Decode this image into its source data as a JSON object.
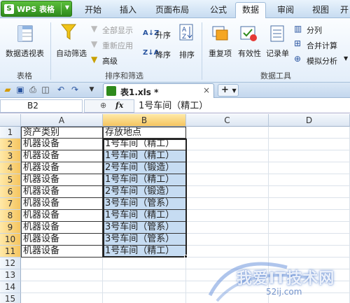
{
  "app": {
    "title": "WPS 表格"
  },
  "menu": {
    "tabs": [
      "开始",
      "插入",
      "页面布局",
      "公式",
      "数据",
      "审阅",
      "视图",
      "开"
    ],
    "active": "数据"
  },
  "ribbon": {
    "pivot": "数据透视表",
    "autofilter": "自动筛选",
    "show_all": "全部显示",
    "reapply": "重新应用",
    "advanced": "高级",
    "sort_asc": "升序",
    "sort_desc": "降序",
    "sort": "排序",
    "duplicates": "重复项",
    "validity": "有效性",
    "record": "记录单",
    "split": "分列",
    "consolidate": "合并计算",
    "simulate": "模拟分析",
    "group_table": "表格",
    "group_sortfilter": "排序和筛选",
    "group_datatools": "数据工具"
  },
  "doc": {
    "tab_name": "表1.xls *",
    "new_tab": "+"
  },
  "formula_bar": {
    "name_box": "B2",
    "fx": "fx",
    "value": "1号车间（精工）"
  },
  "grid": {
    "columns": [
      "A",
      "B",
      "C",
      "D"
    ],
    "rows": [
      {
        "n": "1",
        "a": "资产类别",
        "b": "存放地点"
      },
      {
        "n": "2",
        "a": "机器设备",
        "b": "1号车间（精工）"
      },
      {
        "n": "3",
        "a": "机器设备",
        "b": "1号车间（精工）"
      },
      {
        "n": "4",
        "a": "机器设备",
        "b": "2号车间（锻造）"
      },
      {
        "n": "5",
        "a": "机器设备",
        "b": "1号车间（精工）"
      },
      {
        "n": "6",
        "a": "机器设备",
        "b": "2号车间（锻造）"
      },
      {
        "n": "7",
        "a": "机器设备",
        "b": "3号车间（管系）"
      },
      {
        "n": "8",
        "a": "机器设备",
        "b": "1号车间（精工）"
      },
      {
        "n": "9",
        "a": "机器设备",
        "b": "3号车间（管系）"
      },
      {
        "n": "10",
        "a": "机器设备",
        "b": "3号车间（管系）"
      },
      {
        "n": "11",
        "a": "机器设备",
        "b": "1号车间（精工）"
      },
      {
        "n": "12",
        "a": "",
        "b": ""
      },
      {
        "n": "13",
        "a": "",
        "b": ""
      },
      {
        "n": "14",
        "a": "",
        "b": ""
      },
      {
        "n": "15",
        "a": "",
        "b": ""
      }
    ]
  },
  "watermark": {
    "text": "我爱IT技术网",
    "sub": "52ij.com"
  },
  "colors": {
    "selection": "#c6dcf2",
    "accent_green": "#2e8a1c"
  }
}
